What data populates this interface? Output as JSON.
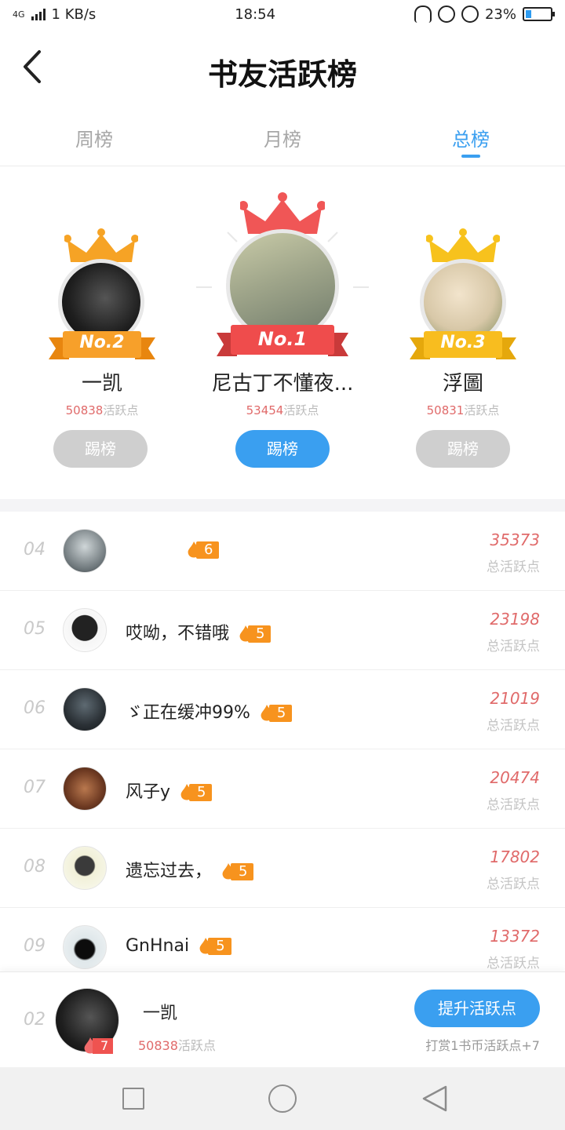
{
  "status_bar": {
    "network": "4G",
    "speed": "1 KB/s",
    "time": "18:54",
    "battery": "23%",
    "battery_level": 0.23,
    "icons": [
      "headphones-icon",
      "rotation-lock-icon",
      "alarm-icon",
      "battery-icon"
    ]
  },
  "header": {
    "title": "书友活跃榜",
    "back_icon": "chevron-left-icon"
  },
  "tabs": [
    {
      "label": "周榜",
      "active": false
    },
    {
      "label": "月榜",
      "active": false
    },
    {
      "label": "总榜",
      "active": true
    }
  ],
  "podium": {
    "first": {
      "rank": "No.1",
      "name": "尼古丁不懂夜...",
      "points": "53454",
      "points_label": "活跃点",
      "button": "踢榜"
    },
    "second": {
      "rank": "No.2",
      "name": "一凯",
      "points": "50838",
      "points_label": "活跃点",
      "button": "踢榜"
    },
    "third": {
      "rank": "No.3",
      "name": "浮圖",
      "points": "50831",
      "points_label": "活跃点",
      "button": "踢榜"
    }
  },
  "list": [
    {
      "index": "04",
      "name": "",
      "level": "6",
      "score": "35373",
      "score_label": "总活跃点"
    },
    {
      "index": "05",
      "name": "哎呦，不错哦",
      "level": "5",
      "score": "23198",
      "score_label": "总活跃点"
    },
    {
      "index": "06",
      "name": "ゞ正在缓冲99%",
      "level": "5",
      "score": "21019",
      "score_label": "总活跃点"
    },
    {
      "index": "07",
      "name": "风子y",
      "level": "5",
      "score": "20474",
      "score_label": "总活跃点"
    },
    {
      "index": "08",
      "name": "遗忘过去，",
      "level": "5",
      "score": "17802",
      "score_label": "总活跃点"
    },
    {
      "index": "09",
      "name": "GnHnai",
      "level": "5",
      "score": "13372",
      "score_label": "总活跃点"
    }
  ],
  "self": {
    "index": "02",
    "name": "一凯",
    "level": "7",
    "points": "50838",
    "points_label": "活跃点",
    "button": "提升活跃点",
    "hint": "打赏1书币活跃点+7"
  },
  "colors": {
    "accent": "#3a9ff0",
    "score_red": "#e06a6a",
    "level_orange": "#f7931e"
  }
}
